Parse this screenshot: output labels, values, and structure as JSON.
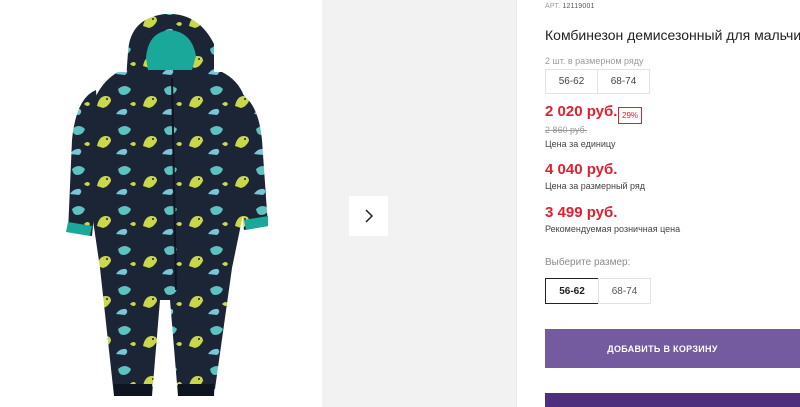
{
  "product": {
    "article_label": "АРТ.",
    "article_value": "12119001",
    "title": "Комбинезон демисезонный для мальчика"
  },
  "pack": {
    "caption": "2 шт. в размерном ряду",
    "sizes": [
      "56-62",
      "68-74"
    ]
  },
  "pricing": {
    "price": "2 020 руб.",
    "discount": "29%",
    "old_price": "2 860 руб.",
    "unit_label": "Цена за единицу",
    "row_price": "4 040 руб.",
    "row_label": "Цена за размерный ряд",
    "rrp": "3 499 руб.",
    "rrp_label": "Рекомендуемая розничная цена"
  },
  "size_select": {
    "caption": "Выберите размер:",
    "options": [
      "56-62",
      "68-74"
    ],
    "selected": "56-62"
  },
  "actions": {
    "add_to_cart": "ДОБАВИТЬ В КОРЗИНУ"
  },
  "colors": {
    "accent_red": "#e0202d",
    "cart_button": "#745a9e",
    "secondary_button": "#4e2f7d",
    "garment_navy": "#1b2536",
    "garment_lining": "#19a89a",
    "print_lime": "#c8d84a",
    "print_teal": "#5cc3c0"
  },
  "icons": {
    "gallery_next": "chevron-right-icon"
  }
}
